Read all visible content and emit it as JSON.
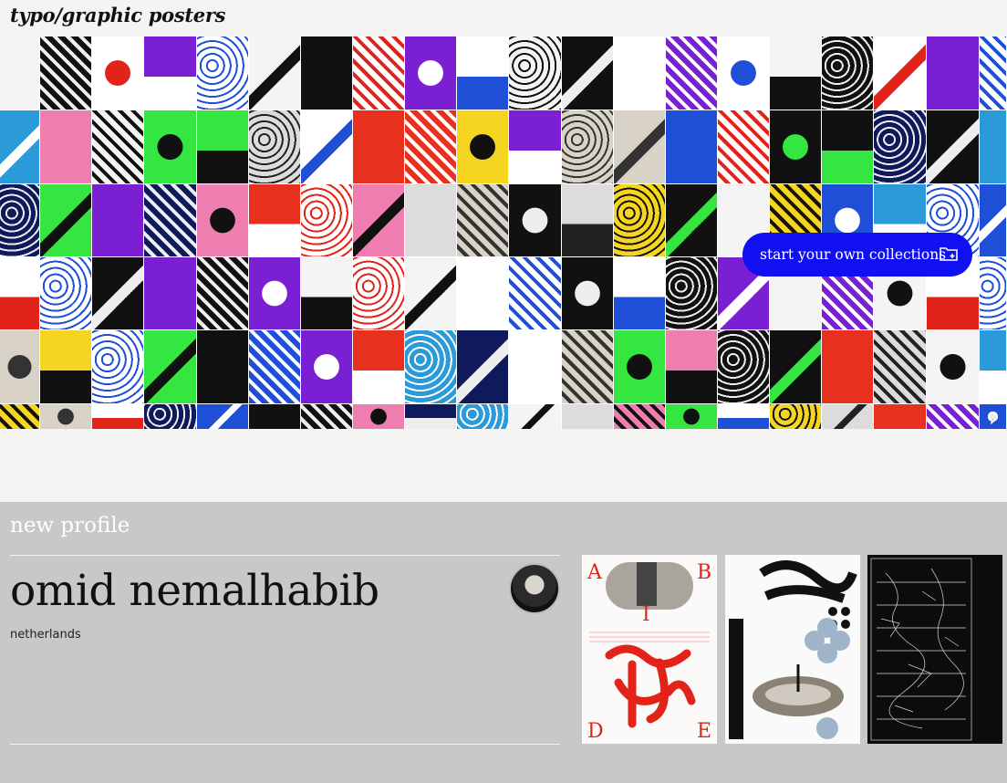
{
  "site": {
    "title": "typo/graphic posters"
  },
  "wall": {
    "next_icon": "chevron-right-icon"
  },
  "cta": {
    "label": "start your own collections",
    "icon": "folder-plus-icon",
    "color": "#1010f0"
  },
  "profile": {
    "section_label": "new profile",
    "name": "omid nemalhabib",
    "country": "netherlands",
    "avatar": "avatar-photo",
    "posters": [
      {
        "theme": "white-red"
      },
      {
        "theme": "white-black"
      },
      {
        "theme": "black"
      }
    ]
  },
  "colors": {
    "profile_bg": "#c8c8c8",
    "page_bg": "#f4f4f2",
    "accent": "#1010f0"
  }
}
